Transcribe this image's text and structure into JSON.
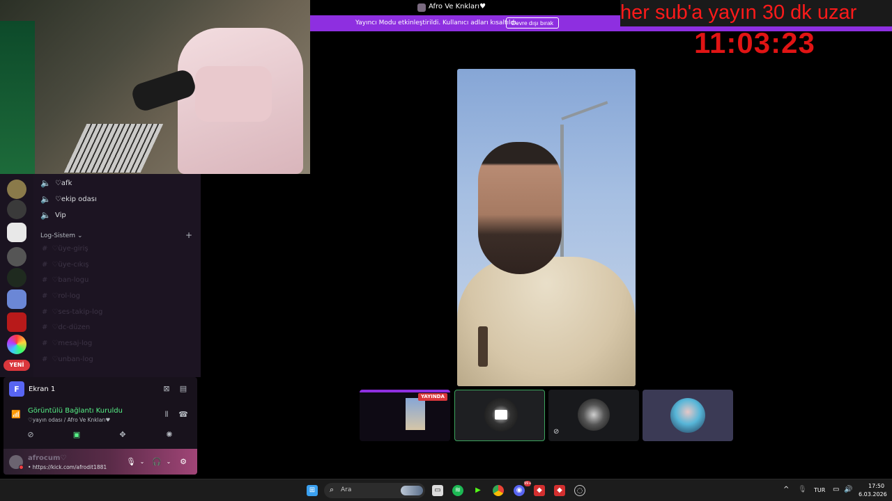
{
  "server": {
    "title": "Afro Ve Knkları♥"
  },
  "streamer_banner": {
    "text": "Yayıncı Modu etkinleştirildi. Kullanıcı adları kısaltıldı.",
    "button": "Devre dışı bırak"
  },
  "overlay": {
    "sub_text": "her sub'a yayın 30 dk uzar",
    "timer": "11:03:23"
  },
  "sidebar": {
    "new_badge": "YENİ",
    "voice_channels": [
      {
        "label": "♡afk"
      },
      {
        "label": "♡ekip odası"
      },
      {
        "label": "Vip"
      }
    ],
    "category": "Log-Sistem",
    "text_channels": [
      {
        "label": "♡üye-giriş"
      },
      {
        "label": "♡üye-cıkış"
      },
      {
        "label": "♡ban-logu"
      },
      {
        "label": "♡rol-log"
      },
      {
        "label": "♡ses-takip-log"
      },
      {
        "label": "♡dc-düzen"
      },
      {
        "label": "♡mesaj-log"
      },
      {
        "label": "♡unban-log"
      }
    ]
  },
  "voice_panel": {
    "screen_avatar": "F",
    "screen_label": "Ekran 1",
    "connection_title": "Görüntülü Bağlantı Kuruldu",
    "connection_sub": "♡yayın odası / Afro Ve Knkları♥"
  },
  "user": {
    "name": "afrocum♡",
    "link": "• https://kick.com/afrodit1881"
  },
  "thumbnails": {
    "live_badge": "YAYINDA"
  },
  "taskbar": {
    "search_label": "Ara",
    "discord_badge": "99+",
    "language": "TUR",
    "time": "17:50",
    "date": "6.03.2026"
  }
}
